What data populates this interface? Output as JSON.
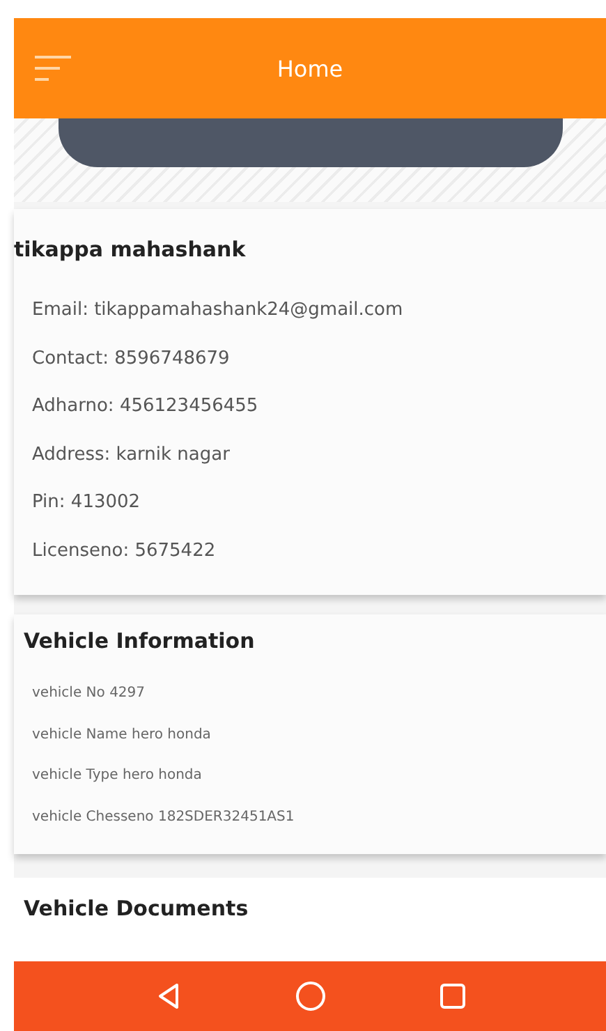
{
  "app_bar": {
    "title": "Home"
  },
  "profile": {
    "name": "tikappa mahashank",
    "fields": [
      "Email: tikappamahashank24@gmail.com",
      "Contact: 8596748679",
      "Adharno: 456123456455",
      "Address: karnik nagar",
      "Pin: 413002",
      "Licenseno: 5675422"
    ]
  },
  "vehicle_information": {
    "title": "Vehicle Information",
    "fields": [
      "vehicle No 4297",
      "vehicle Name hero honda",
      "vehicle Type hero honda",
      "vehicle Chesseno 182SDER32451AS1"
    ]
  },
  "vehicle_documents": {
    "title": "Vehicle Documents"
  }
}
